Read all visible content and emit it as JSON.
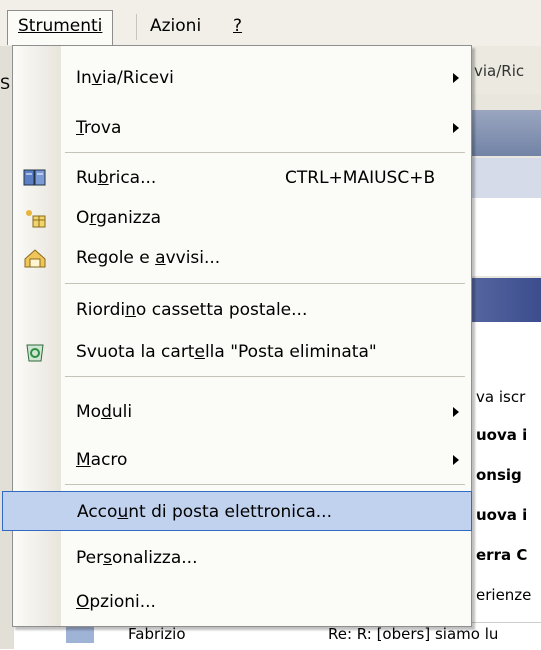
{
  "menubar": {
    "items": [
      "Strumenti",
      "Azioni",
      "?"
    ],
    "left_fragment": "S"
  },
  "background": {
    "toolbar_fragment": "via/Ric",
    "list": [
      "va iscr",
      "uova i",
      "onsig",
      "uova i",
      "erra C",
      "erienze"
    ],
    "bottom_row": {
      "sender": "Fabrizio",
      "subject": "Re: R: [obers] siamo lu"
    }
  },
  "menu": {
    "items": [
      {
        "label_pre": "In",
        "label_ul": "v",
        "label_post": "ia/Ricevi",
        "shortcut": "",
        "submenu": true,
        "icon": ""
      },
      {
        "label_pre": "",
        "label_ul": "T",
        "label_post": "rova",
        "shortcut": "",
        "submenu": true,
        "icon": ""
      },
      {
        "label_pre": "Ru",
        "label_ul": "b",
        "label_post": "rica...",
        "shortcut": "CTRL+MAIUSC+B",
        "submenu": false,
        "icon": "address-book-icon"
      },
      {
        "label_pre": "O",
        "label_ul": "r",
        "label_post": "ganizza",
        "shortcut": "",
        "submenu": false,
        "icon": "organize-icon"
      },
      {
        "label_pre": "Regole e ",
        "label_ul": "a",
        "label_post": "vvisi...",
        "shortcut": "",
        "submenu": false,
        "icon": "rules-icon"
      },
      {
        "label_pre": "Riordi",
        "label_ul": "n",
        "label_post": "o cassetta postale...",
        "shortcut": "",
        "submenu": false,
        "icon": ""
      },
      {
        "label_pre": "Svuota la cart",
        "label_ul": "e",
        "label_post": "lla \"Posta eliminata\"",
        "shortcut": "",
        "submenu": false,
        "icon": "recycle-bin-icon"
      },
      {
        "label_pre": "Mo",
        "label_ul": "d",
        "label_post": "uli",
        "shortcut": "",
        "submenu": true,
        "icon": ""
      },
      {
        "label_pre": "",
        "label_ul": "M",
        "label_post": "acro",
        "shortcut": "",
        "submenu": true,
        "icon": ""
      },
      {
        "label_pre": "Acco",
        "label_ul": "u",
        "label_post": "nt di posta elettronica...",
        "shortcut": "",
        "submenu": false,
        "icon": ""
      },
      {
        "label_pre": "Per",
        "label_ul": "s",
        "label_post": "onalizza...",
        "shortcut": "",
        "submenu": false,
        "icon": ""
      },
      {
        "label_pre": "",
        "label_ul": "O",
        "label_post": "pzioni...",
        "shortcut": "",
        "submenu": false,
        "icon": ""
      }
    ]
  },
  "colors": {
    "highlight": "#c1d2ee",
    "highlight_border": "#316ac5",
    "menu_bg": "#fbfbf8"
  }
}
